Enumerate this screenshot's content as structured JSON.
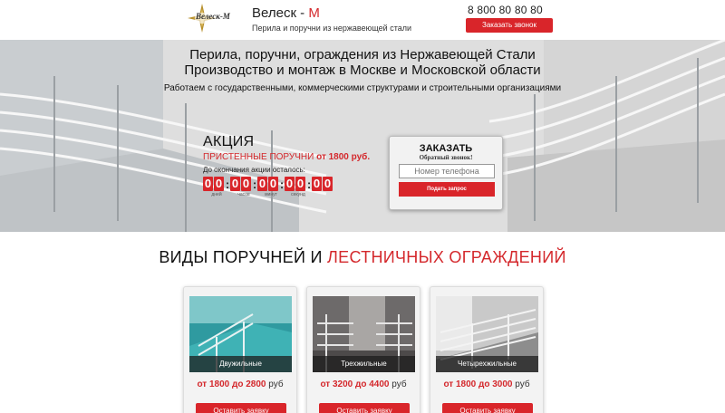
{
  "header": {
    "logo_text": "Велеск-М",
    "brand_name": "Велеск - ",
    "brand_letter": "М",
    "brand_sub": "Перила и поручни из нержавеющей стали",
    "phone": "8 800 80 80 80",
    "callback_label": "Заказать звонок"
  },
  "hero": {
    "title_line1": "Перила, поручни, ограждения из Нержавеющей Стали",
    "title_line2": "Производство и монтаж в Москве и Московской области",
    "subtitle": "Работаем с государственными, коммерческими структурами и строительными организациями"
  },
  "promo": {
    "title": "АКЦИЯ",
    "line_prefix": "ПРИСТЕННЫЕ ПОРУЧНИ ",
    "line_price": "от 1800 руб.",
    "remaining": "До окончания акции осталось:",
    "digits": [
      "0",
      "0",
      "0",
      "0",
      "0",
      "0",
      "0",
      "0",
      "0",
      "0"
    ],
    "labels": [
      "дней",
      "часов",
      "минут",
      "секунд"
    ]
  },
  "order": {
    "title": "ЗАКАЗАТЬ",
    "subtitle": "Обратный звонок!",
    "phone_placeholder": "Номер телефона",
    "submit_label": "Подать запрос"
  },
  "section": {
    "title_black": "ВИДЫ ПОРУЧНЕЙ И ",
    "title_red": "ЛЕСТНИЧНЫХ ОГРАЖДЕНИЙ"
  },
  "cards": [
    {
      "caption": "Двужильные",
      "from": "от 1800",
      "to": "до 2800",
      "unit": "руб",
      "button": "Оставить заявку"
    },
    {
      "caption": "Трехжильные",
      "from": "от 3200",
      "to": "до 4400",
      "unit": "руб",
      "button": "Оставить заявку"
    },
    {
      "caption": "Четырехжильные",
      "from": "от 1800",
      "to": "до 3000",
      "unit": "руб",
      "button": "Оставить заявку"
    }
  ],
  "colors": {
    "accent": "#d9252a",
    "dark": "#111111"
  }
}
